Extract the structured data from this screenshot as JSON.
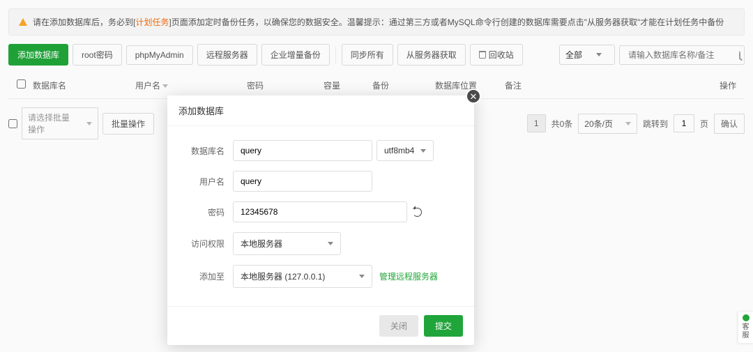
{
  "alert": {
    "pre": "请在添加数据库后，务必到[",
    "link": "计划任务",
    "post": "]页面添加定时备份任务，以确保您的数据安全。温馨提示：通过第三方或者MySQL命令行创建的数据库需要点击\"从服务器获取\"才能在计划任务中备份"
  },
  "toolbar": {
    "add": "添加数据库",
    "root": "root密码",
    "phpmyadmin": "phpMyAdmin",
    "remote": "远程服务器",
    "backup": "企业增量备份",
    "syncall": "同步所有",
    "fetch": "从服务器获取",
    "trash": "回收站",
    "filter_all": "全部",
    "search_ph": "请输入数据库名称/备注"
  },
  "columns": {
    "name": "数据库名",
    "user": "用户名",
    "pwd": "密码",
    "size": "容量",
    "backup": "备份",
    "loc": "数据库位置",
    "remark": "备注",
    "ops": "操作"
  },
  "bulk": {
    "select_ph": "请选择批量操作",
    "btn": "批量操作"
  },
  "pager": {
    "page": "1",
    "total": "共0条",
    "perpage": "20条/页",
    "jump": "跳转到",
    "page_input": "1",
    "unit": "页",
    "confirm": "确认"
  },
  "modal": {
    "title": "添加数据库",
    "labels": {
      "dbname": "数据库名",
      "user": "用户名",
      "pwd": "密码",
      "perm": "访问权限",
      "addto": "添加至"
    },
    "values": {
      "dbname": "query",
      "charset": "utf8mb4",
      "user": "query",
      "pwd": "12345678",
      "perm": "本地服务器",
      "addto": "本地服务器 (127.0.0.1)"
    },
    "manage_remote": "管理远程服务器",
    "close": "关闭",
    "submit": "提交"
  },
  "side": {
    "label": "客服"
  }
}
